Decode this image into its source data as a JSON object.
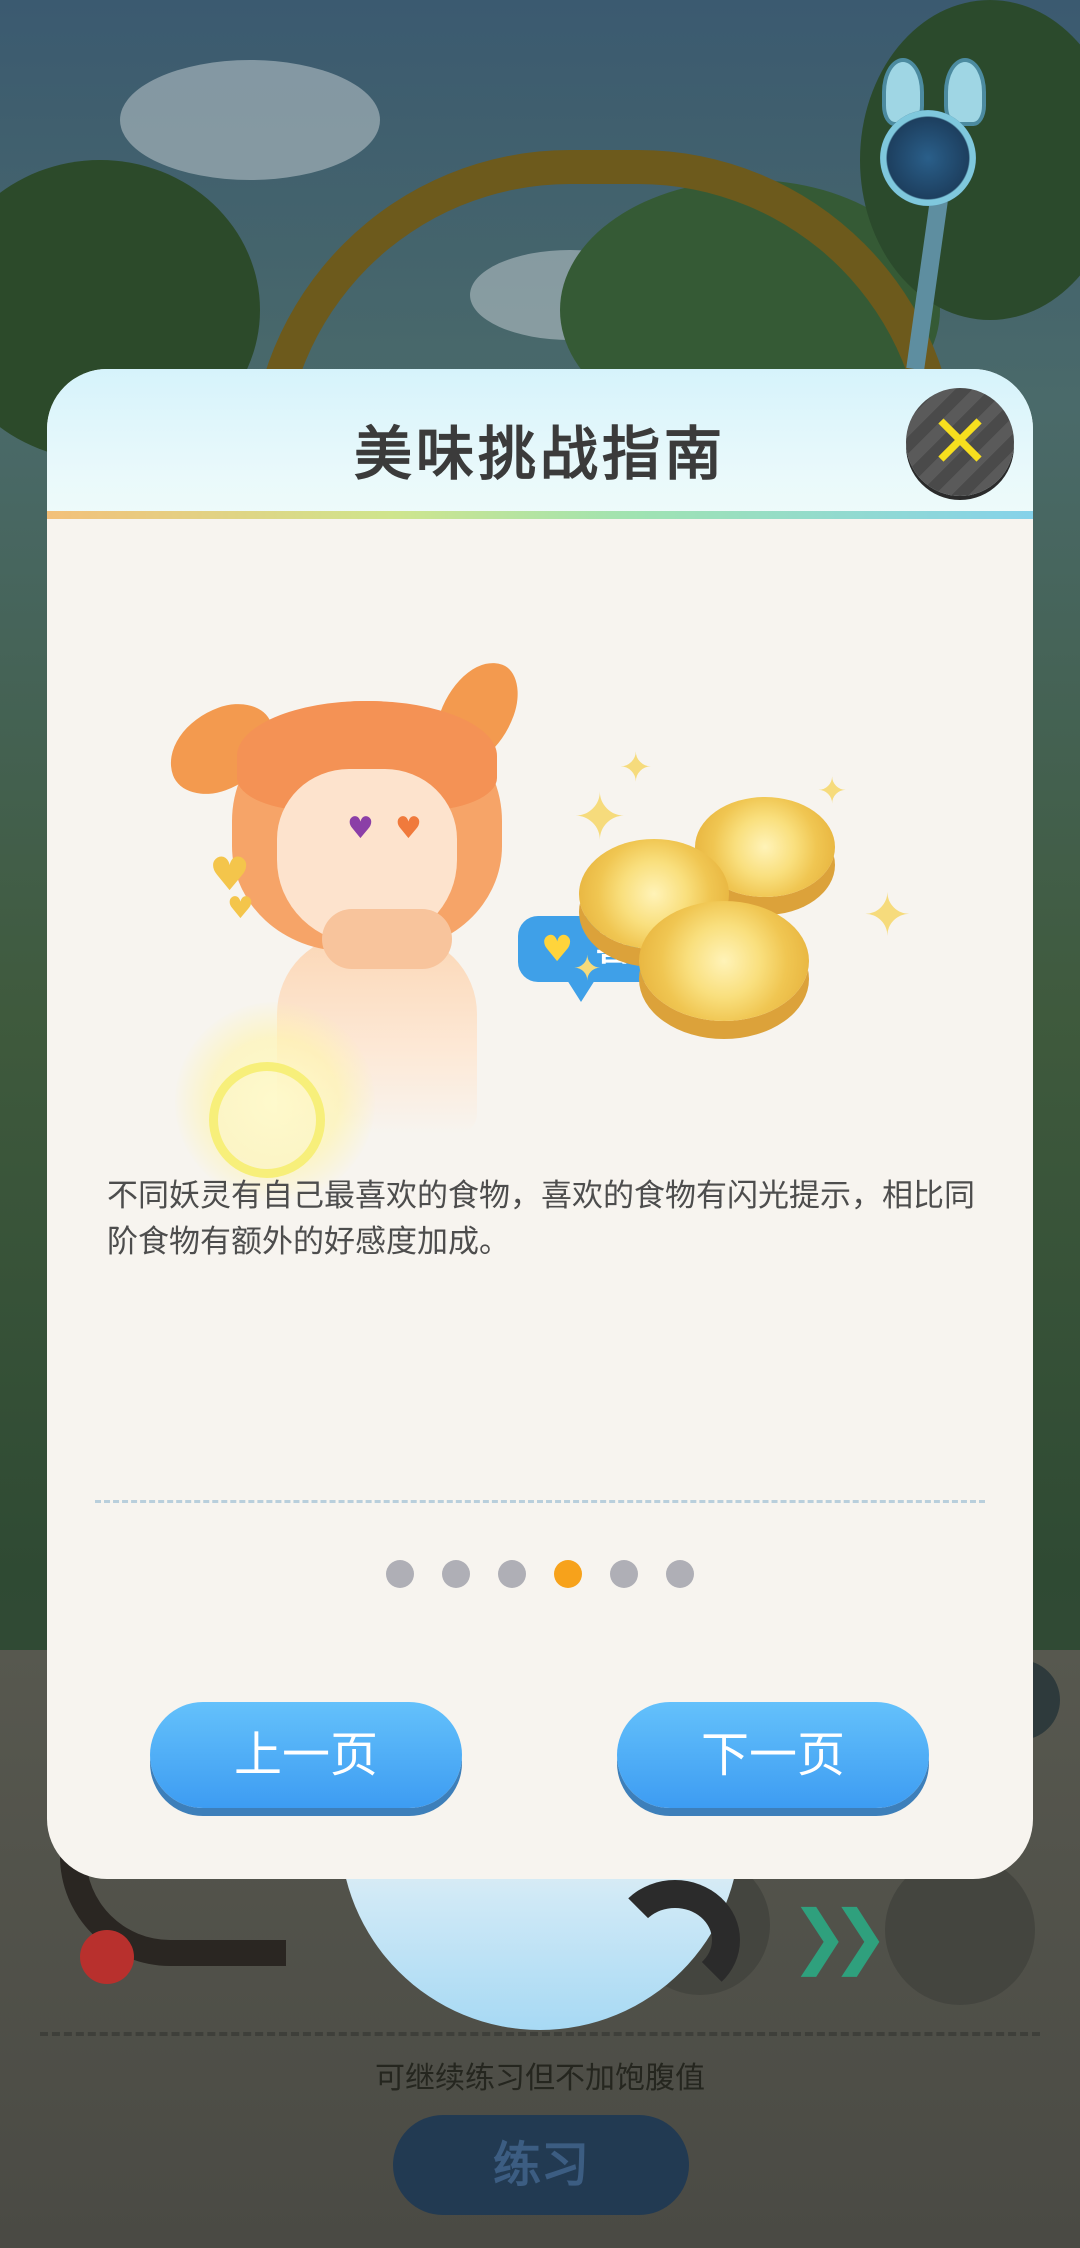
{
  "dialog": {
    "title": "美味挑战指南",
    "close_icon": "close-icon",
    "bubble_text": "喜欢~",
    "description": "不同妖灵有自己最喜欢的食物，喜欢的食物有闪光提示，相比同阶食物有额外的好感度加成。",
    "pagination": {
      "total": 6,
      "current": 4
    },
    "prev_label": "上一页",
    "next_label": "下一页"
  },
  "background": {
    "hint_text": "可继续练习但不加饱腹值",
    "practice_label": "练习"
  },
  "colors": {
    "accent_orange": "#f7a21b",
    "button_blue": "#3d9cf2",
    "close_yellow": "#f7df1e"
  }
}
